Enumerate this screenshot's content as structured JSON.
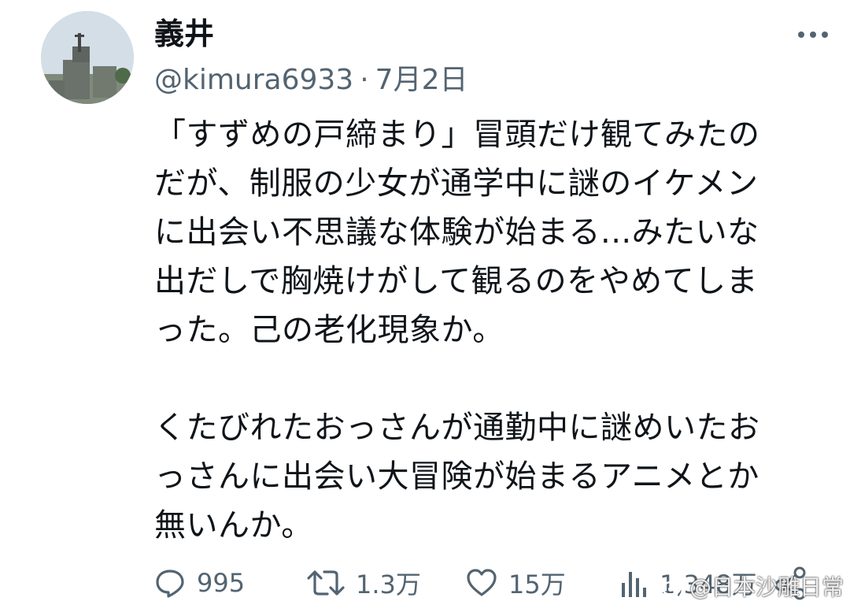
{
  "tweet": {
    "display_name": "義井",
    "handle": "@kimura6933",
    "separator": "·",
    "date": "7月2日",
    "paragraphs": [
      [
        "「すずめの戸締まり」冒頭だけ観てみたの",
        "だが、制服の少女が通学中に謎のイケメン",
        "に出会い不思議な体験が始まる...みたいな",
        "出だしで胸焼けがして観るのをやめてしま",
        "った。己の老化現象か。"
      ],
      [
        "くたびれたおっさんが通勤中に謎めいたお",
        "っさんに出会い大冒険が始まるアニメとか",
        "無いんか。"
      ]
    ]
  },
  "actions": {
    "replies": "995",
    "retweets": "1.3万",
    "likes": "15万",
    "views": "1,348万"
  },
  "icons": {
    "more": "more-horizontal-icon",
    "reply": "speech-bubble-icon",
    "retweet": "retweet-arrows-icon",
    "like": "heart-icon",
    "views": "bar-chart-icon",
    "share": "share-nodes-icon"
  },
  "watermark": "@日本沙雕日常",
  "colors": {
    "text": "#0f1419",
    "secondary": "#536471",
    "background": "#ffffff"
  }
}
